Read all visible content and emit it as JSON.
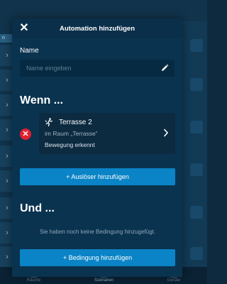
{
  "background": {
    "left_tag": "n",
    "bottom_tabs": [
      "Räume",
      "Szenarien",
      "Geräte"
    ]
  },
  "modal": {
    "title": "Automation hinzufügen",
    "name_label": "Name",
    "name_placeholder": "Name eingeben",
    "name_value": ""
  },
  "wenn": {
    "heading": "Wenn ...",
    "trigger": {
      "title": "Terrasse 2",
      "room": "im Raum „Terrasse“",
      "event": "Bewegung erkennt",
      "icon": "motion-icon"
    },
    "add_button": "+ Auslöser hinzufügen"
  },
  "und": {
    "heading": "Und ...",
    "empty_text": "Sie haben noch keine Bedingung hinzugefügt.",
    "add_button": "+ Bedingung hinzufügen"
  },
  "colors": {
    "modal_bg": "#0a3350",
    "accent": "#0a84c6",
    "danger": "#e2202e"
  }
}
